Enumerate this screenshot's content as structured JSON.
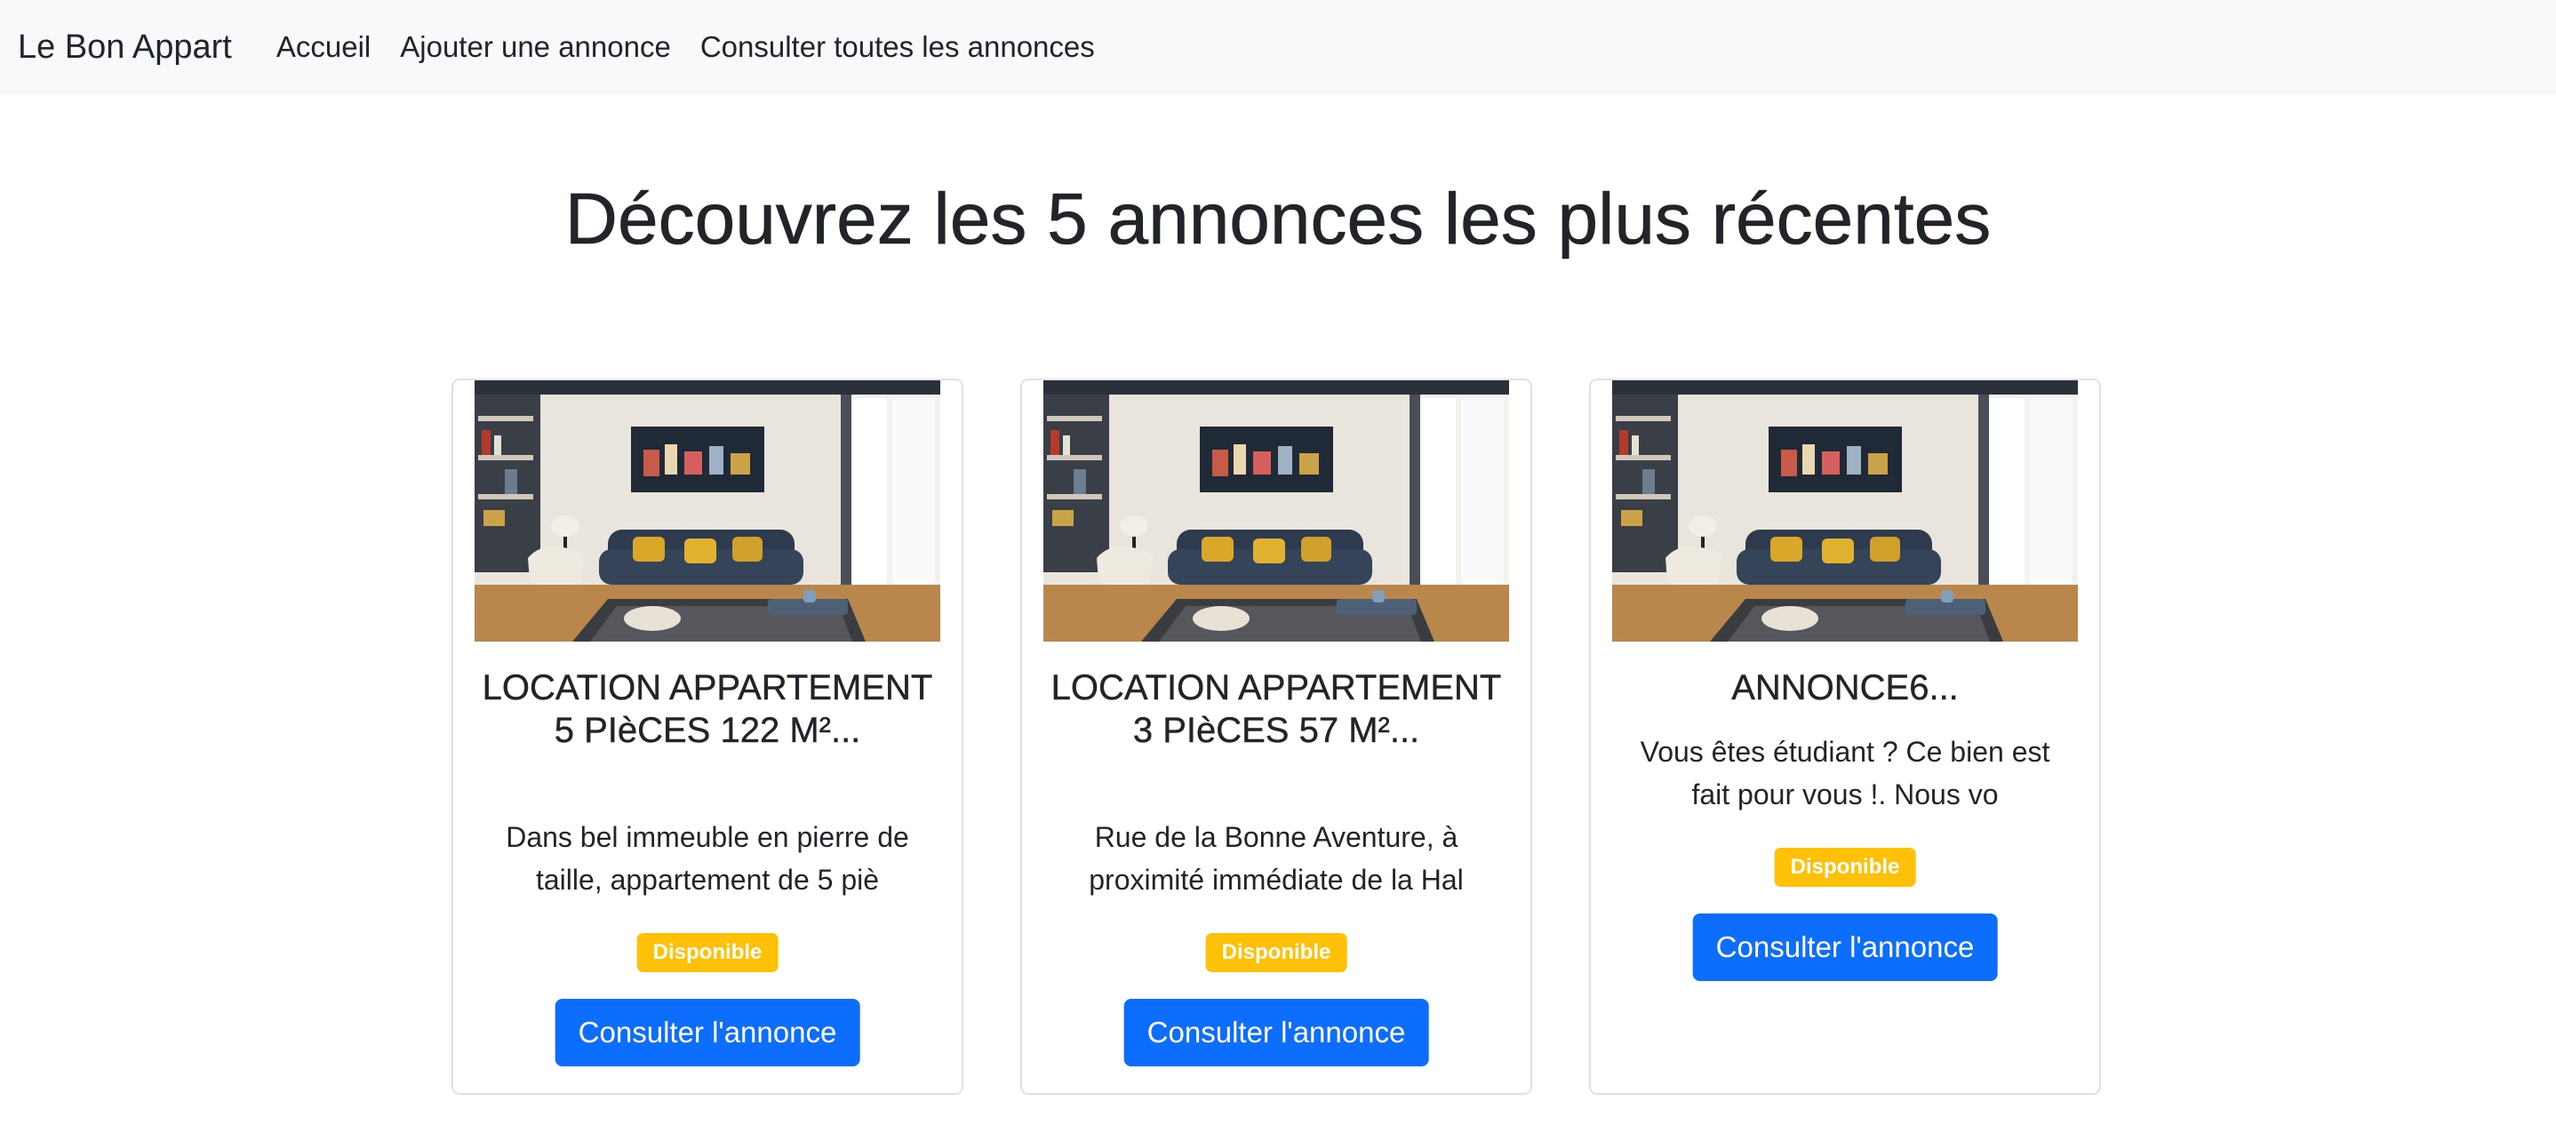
{
  "navbar": {
    "brand": "Le Bon Appart",
    "links": [
      "Accueil",
      "Ajouter une annonce",
      "Consulter toutes les annonces"
    ]
  },
  "main": {
    "heading": "Découvrez les 5 annonces les plus récentes"
  },
  "cards": [
    {
      "title": "LOCATION APPARTEMENT 5 PIèCES 122 M²...",
      "text": "Dans bel immeuble en pierre de taille, appartement de 5 piè",
      "badge": "Disponible",
      "button": "Consulter l'annonce"
    },
    {
      "title": "LOCATION APPARTEMENT 3 PIèCES 57 M²...",
      "text": "Rue de la Bonne Aventure, à proximité immédiate de la Hal",
      "badge": "Disponible",
      "button": "Consulter l'annonce"
    },
    {
      "title": "ANNONCE6...",
      "text": "Vous êtes étudiant ? Ce bien est fait pour vous !. Nous vo",
      "badge": "Disponible",
      "button": "Consulter l'annonce"
    }
  ],
  "colors": {
    "navbar_bg": "#f8f9fa",
    "primary_button": "#0d6efd",
    "badge_warning": "#ffc107",
    "text": "#212529"
  }
}
